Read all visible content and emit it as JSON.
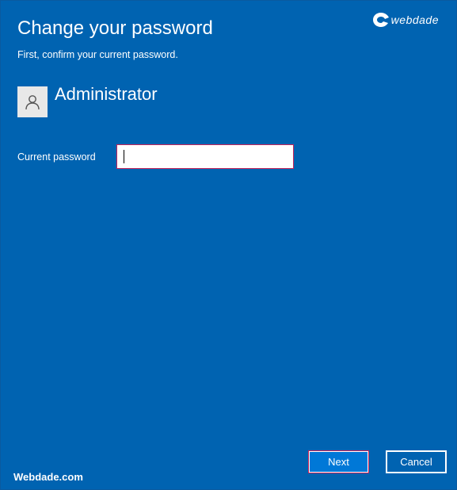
{
  "dialog": {
    "title": "Change your password",
    "subtitle": "First, confirm your current password.",
    "brand": "webdade",
    "user": {
      "name": "Administrator",
      "avatar_icon": "user-icon"
    },
    "field": {
      "label": "Current password",
      "value": "",
      "placeholder": ""
    },
    "footer_brand": "Webdade.com",
    "buttons": {
      "next_label": "Next",
      "cancel_label": "Cancel"
    }
  },
  "colors": {
    "background": "#0063b1",
    "accent_border": "#c8245a",
    "text": "#ffffff"
  }
}
